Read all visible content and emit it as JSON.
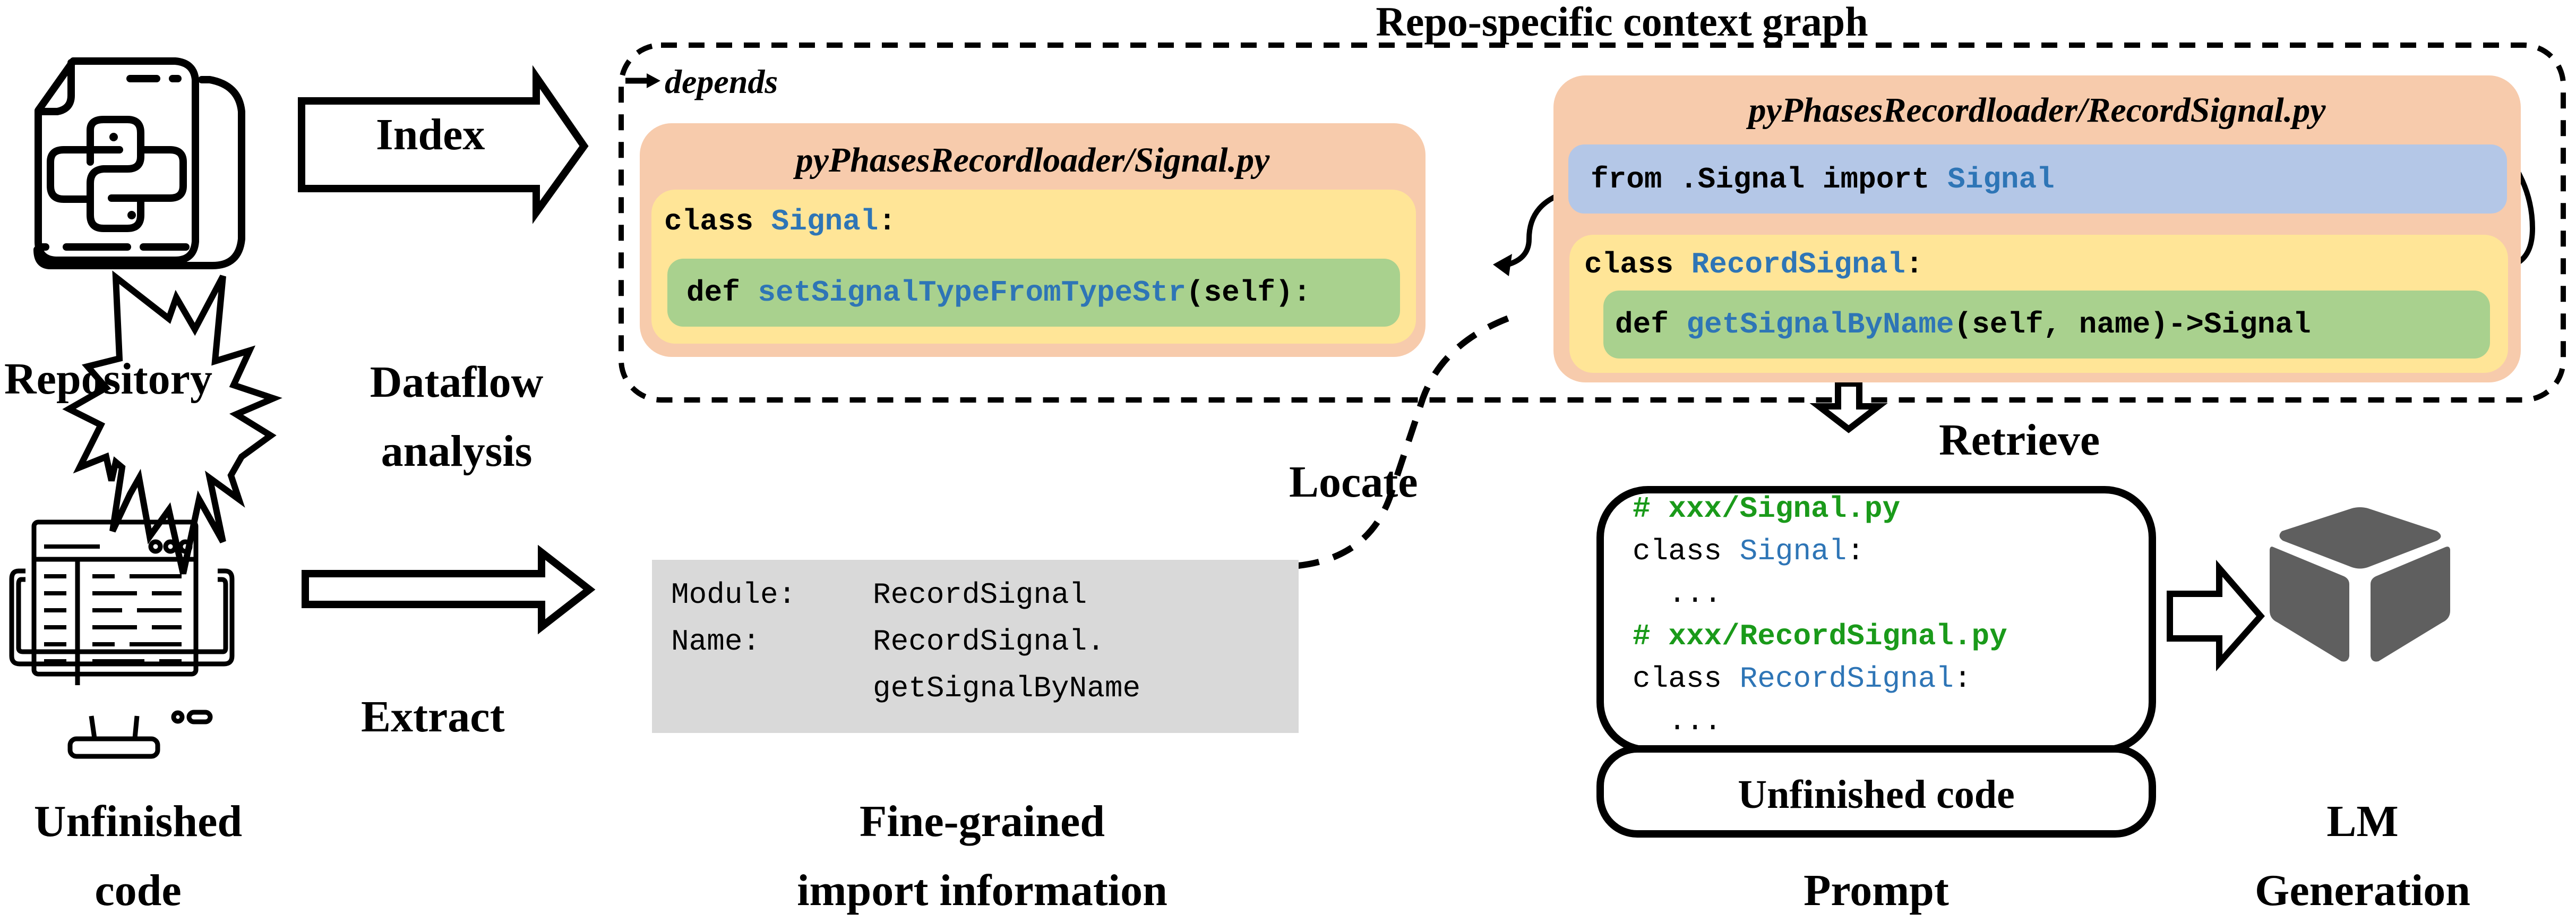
{
  "title": "Repo-specific context graph",
  "legend": {
    "arrow_label": "depends"
  },
  "left": {
    "repository_label": "Repository",
    "unfinished_code_label_line1": "Unfinished",
    "unfinished_code_label_line2": "code",
    "dataflow_line1": "Dataflow",
    "dataflow_line2": "analysis",
    "index_label": "Index",
    "extract_label": "Extract"
  },
  "graph": {
    "signal_file": {
      "title": "pyPhasesRecordloader/Signal.py",
      "class_kw": "class ",
      "class_name": "Signal",
      "class_colon": ":",
      "def_kw": "def ",
      "def_name": "setSignalTypeFromTypeStr",
      "def_rest": "(self):"
    },
    "record_file": {
      "title": "pyPhasesRecordloader/RecordSignal.py",
      "import_prefix": "from .Signal import ",
      "import_name": "Signal",
      "class_kw": "class ",
      "class_name": "RecordSignal",
      "class_colon": ":",
      "def_kw": "def ",
      "def_name": "getSignalByName",
      "def_rest": "(self, name)->Signal"
    }
  },
  "import_info": {
    "module_key": "Module:",
    "module_val": "RecordSignal",
    "name_key": "Name:",
    "name_val_line1": "RecordSignal.",
    "name_val_line2": "getSignalByName",
    "caption_line1": "Fine-grained",
    "caption_line2": "import information"
  },
  "locate_label": "Locate",
  "retrieve_label": "Retrieve",
  "prompt": {
    "lines": [
      {
        "type": "comment",
        "text": "# xxx/Signal.py"
      },
      {
        "type": "class",
        "kw": "class ",
        "name": "Signal",
        "tail": ":"
      },
      {
        "type": "plain",
        "text": "  ..."
      },
      {
        "type": "comment",
        "text": "# xxx/RecordSignal.py"
      },
      {
        "type": "class",
        "kw": "class ",
        "name": "RecordSignal",
        "tail": ":"
      },
      {
        "type": "plain",
        "text": "  ..."
      }
    ],
    "unfinished_code": "Unfinished code",
    "caption": "Prompt"
  },
  "lm": {
    "caption_line1": "LM",
    "caption_line2": "Generation"
  },
  "colors": {
    "file_bg": "#f7cbac",
    "class_bg": "#ffe597",
    "func_bg": "#a9d18e",
    "import_bg": "#b4c7e7",
    "info_bg": "#d9d9d9",
    "name_blue": "#2e75b6",
    "comment_green": "#1a9a1a",
    "lm_gray": "#5f5f5f"
  }
}
